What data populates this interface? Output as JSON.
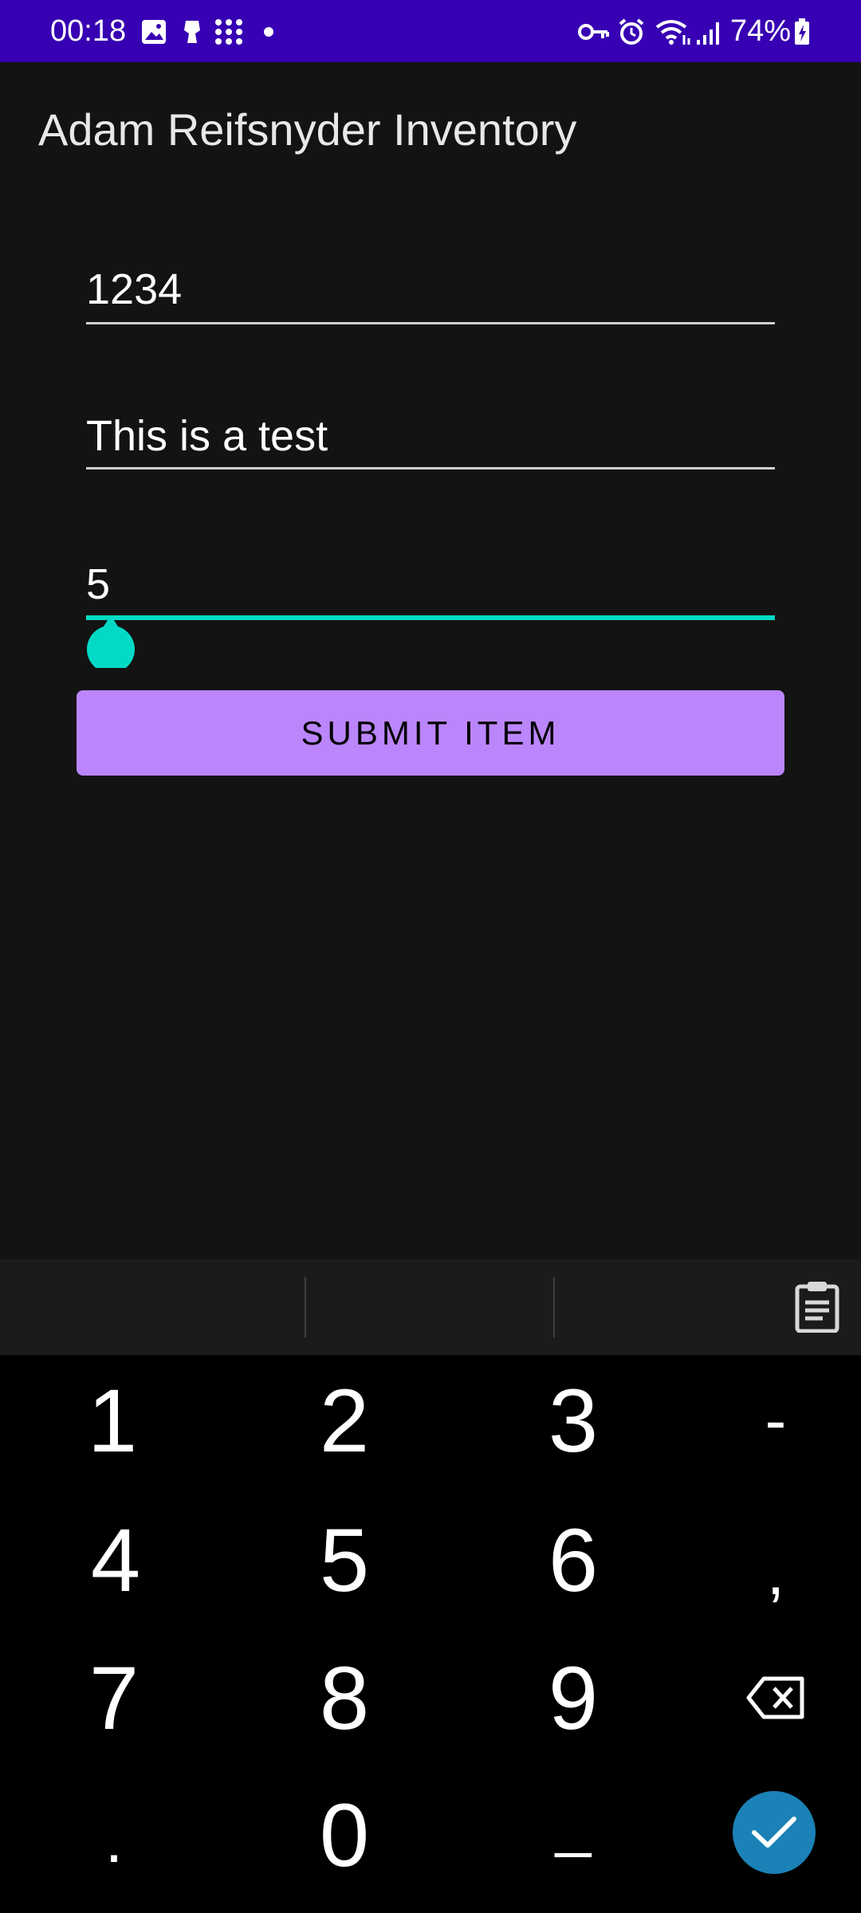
{
  "status_bar": {
    "time": "00:18",
    "battery": "74%",
    "left_icons": [
      "gallery-icon",
      "notification-app-icon",
      "apps-grid-icon",
      "dot-icon"
    ],
    "right_icons": [
      "vpn-key-icon",
      "alarm-icon",
      "wifi-icon",
      "signal-icon",
      "battery-icon"
    ]
  },
  "app": {
    "title": "Adam Reifsnyder Inventory"
  },
  "form": {
    "field1": {
      "value": "1234"
    },
    "field2": {
      "value": "This is a test"
    },
    "field3": {
      "value": "5"
    },
    "submit_label": "SUBMIT ITEM"
  },
  "keyboard": {
    "rows": [
      [
        "1",
        "2",
        "3",
        "-"
      ],
      [
        "4",
        "5",
        "6",
        ","
      ],
      [
        "7",
        "8",
        "9",
        "backspace"
      ],
      [
        ".",
        "0",
        "_",
        "done"
      ]
    ],
    "accent": "#1a82b6"
  },
  "colors": {
    "status_bar": "#3700b3",
    "background": "#131313",
    "button": "#bb86fc",
    "accent": "#03dac5"
  }
}
